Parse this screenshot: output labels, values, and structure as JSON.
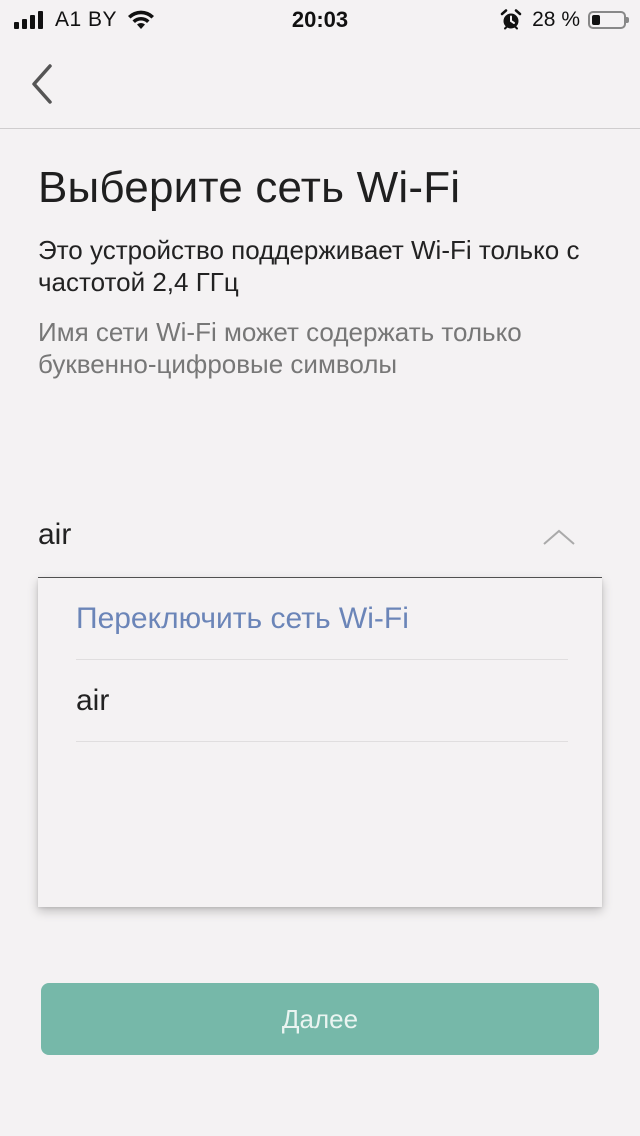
{
  "status_bar": {
    "carrier": "A1 BY",
    "time": "20:03",
    "battery_percent": "28 %",
    "battery_level": 0.28,
    "icons": [
      "signal-icon",
      "wifi-icon",
      "alarm-icon",
      "battery-icon"
    ]
  },
  "nav": {
    "back_icon": "chevron-left-icon"
  },
  "page": {
    "title": "Выберите сеть Wi-Fi",
    "subtitle": "Это устройство поддерживает Wi-Fi только с частотой 2,4 ГГц",
    "hint": "Имя сети Wi-Fi может содержать только буквенно-цифровые символы"
  },
  "network_select": {
    "value": "air",
    "icon": "chevron-up-icon",
    "options": [
      {
        "label": "Переключить сеть Wi-Fi"
      },
      {
        "label": "air"
      }
    ]
  },
  "actions": {
    "next_label": "Далее"
  },
  "colors": {
    "background": "#f4f2f3",
    "link": "#6b85b8",
    "button": "#76b8a9",
    "button_text": "#eaf4f1"
  }
}
